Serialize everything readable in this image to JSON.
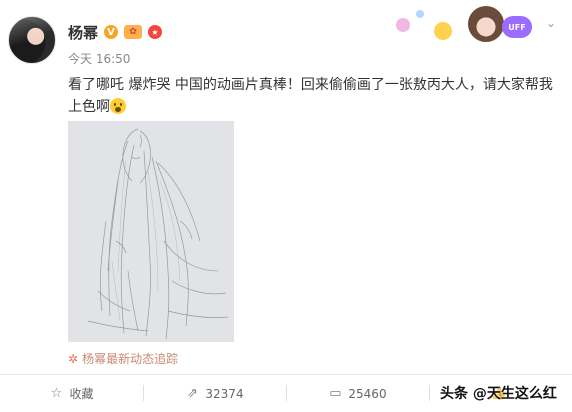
{
  "header": {
    "name": "杨幂",
    "badge_v": "V",
    "time": "今天 16:50"
  },
  "post": {
    "text": "看了哪吒 爆炸哭 中国的动画片真棒！回来偷偷画了一张敖丙大人，请大家帮我上色啊",
    "image_alt_icon": "pencil-sketch-image"
  },
  "banner": {
    "tag": "UFF"
  },
  "footer": {
    "track_label": "杨幂最新动态追踪"
  },
  "actions": {
    "favorite_label": "收藏",
    "repost_count": "32374",
    "comment_count": "25460",
    "like_count": ""
  },
  "watermark": "头条 @天生这么红",
  "colors": {
    "accent": "#eb7350",
    "verified": "#f6a623"
  }
}
